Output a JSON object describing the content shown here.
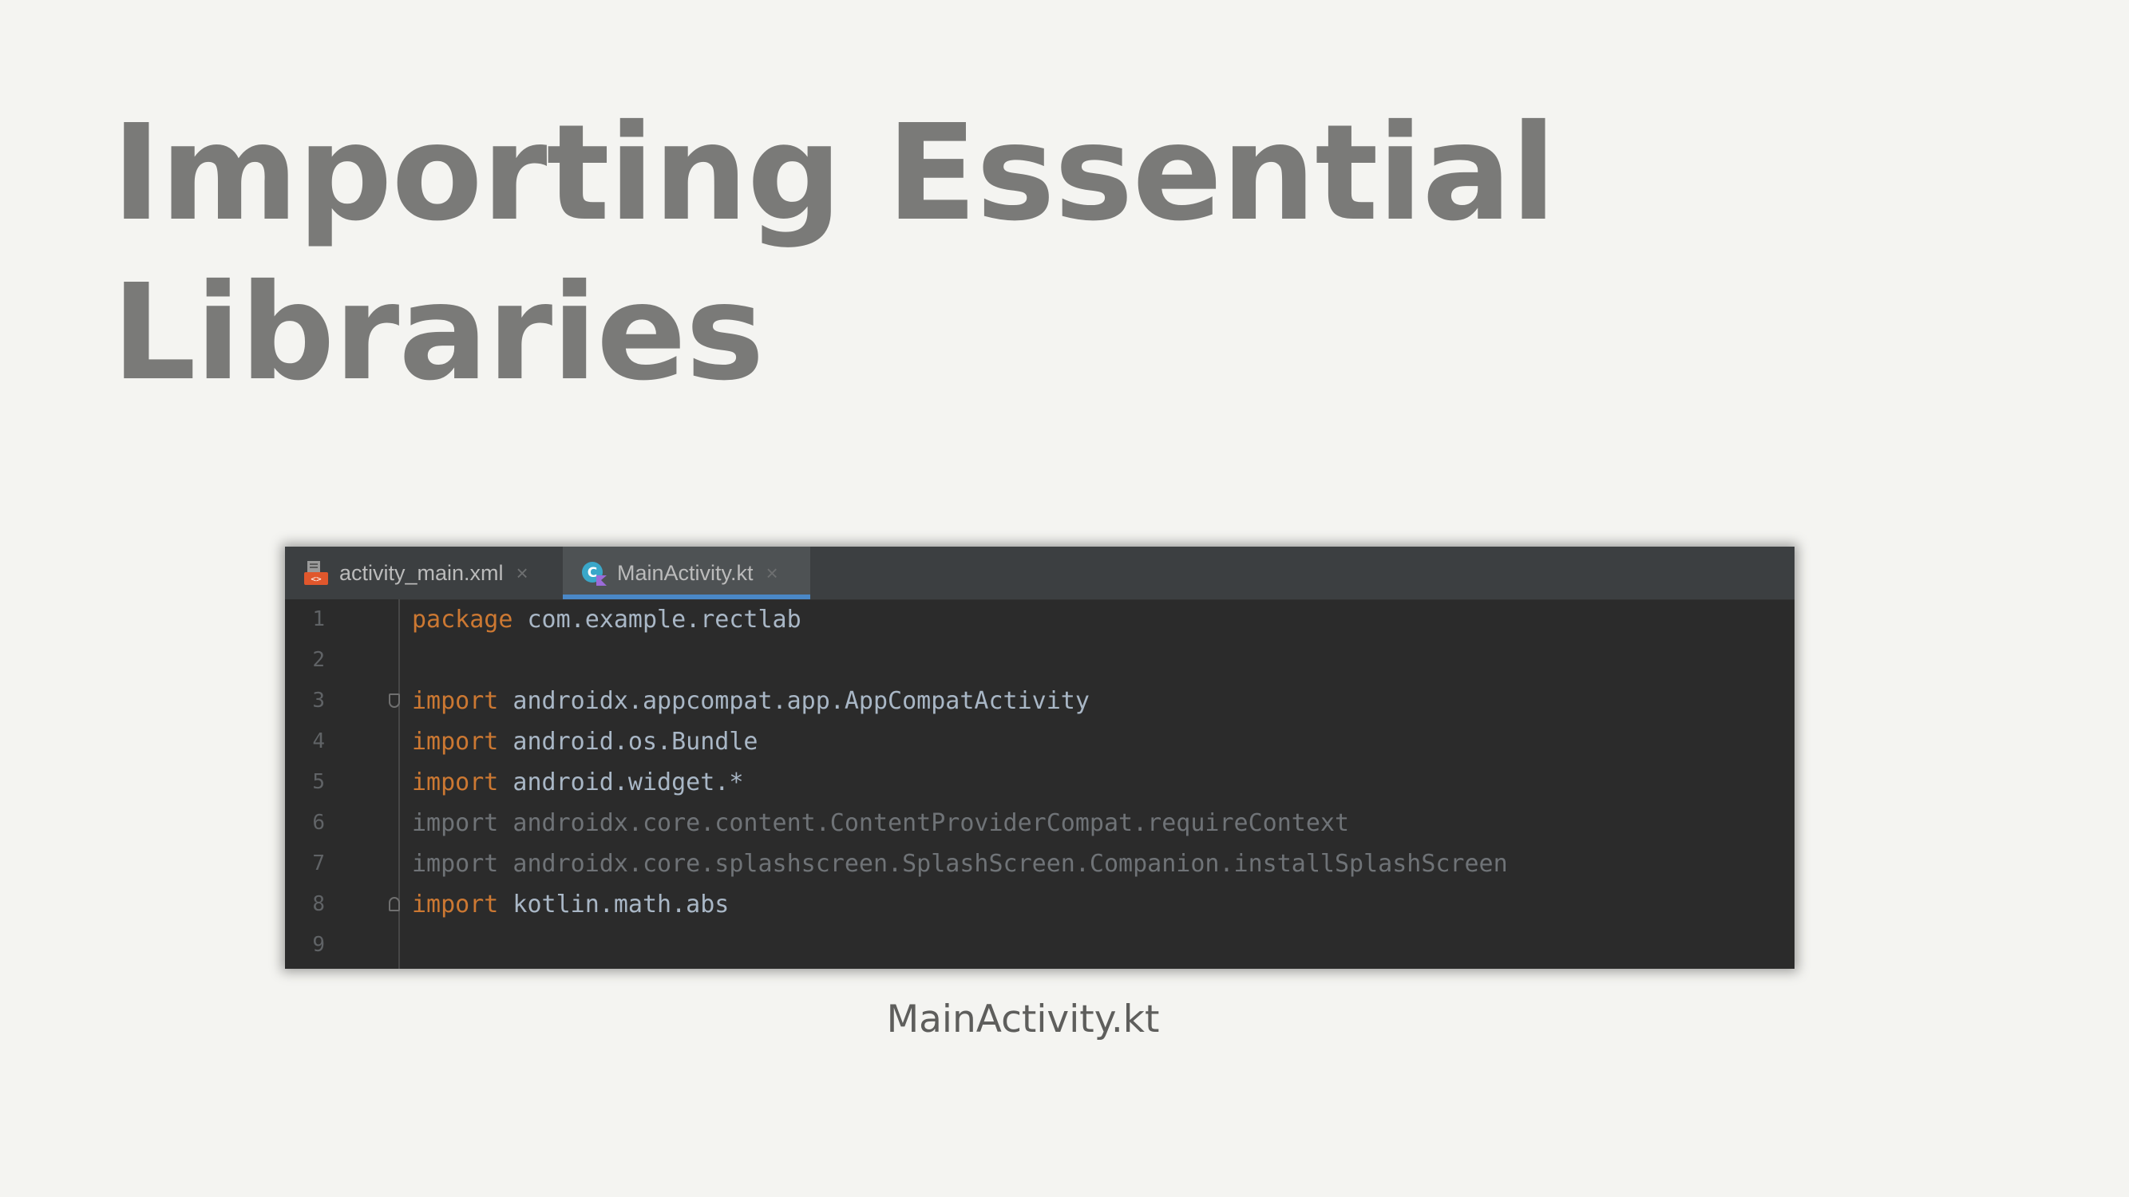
{
  "slide": {
    "title_line1": "Importing Essential",
    "title_line2": "Libraries",
    "caption": "MainActivity.kt"
  },
  "editor": {
    "tabs": [
      {
        "label": "activity_main.xml",
        "icon": "xml-file-icon",
        "close": "×",
        "active": false
      },
      {
        "label": "MainActivity.kt",
        "icon": "kotlin-file-icon",
        "close": "×",
        "active": true
      }
    ],
    "lines": [
      {
        "num": "1",
        "keyword": "package",
        "text": " com.example.rectlab",
        "dim": false
      },
      {
        "num": "2",
        "keyword": "",
        "text": "",
        "dim": false
      },
      {
        "num": "3",
        "keyword": "import",
        "text": " androidx.appcompat.app.AppCompatActivity",
        "dim": false
      },
      {
        "num": "4",
        "keyword": "import",
        "text": " android.os.Bundle",
        "dim": false
      },
      {
        "num": "5",
        "keyword": "import",
        "text": " android.widget.*",
        "dim": false
      },
      {
        "num": "6",
        "keyword": "import",
        "text": " androidx.core.content.ContentProviderCompat.requireContext",
        "dim": true
      },
      {
        "num": "7",
        "keyword": "import",
        "text": " androidx.core.splashscreen.SplashScreen.Companion.installSplashScreen",
        "dim": true
      },
      {
        "num": "8",
        "keyword": "import",
        "text": " kotlin.math.abs",
        "dim": false
      },
      {
        "num": "9",
        "keyword": "",
        "text": "",
        "dim": false
      }
    ],
    "colors": {
      "background": "#2b2b2b",
      "keyword": "#cc7832",
      "identifier": "#a9b7c6",
      "unused_import": "#6f7377",
      "active_tab_underline": "#4a88c7"
    }
  }
}
